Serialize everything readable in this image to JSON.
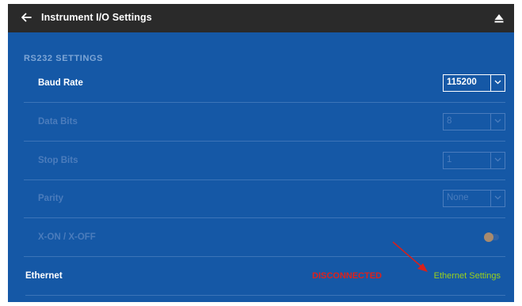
{
  "header": {
    "title": "Instrument I/O Settings",
    "back_icon": "arrow-left-icon",
    "eject_icon": "eject-icon"
  },
  "section": {
    "title": "RS232 SETTINGS"
  },
  "rows": [
    {
      "label": "Baud Rate",
      "value": "115200",
      "enabled": true
    },
    {
      "label": "Data Bits",
      "value": "8",
      "enabled": false
    },
    {
      "label": "Stop Bits",
      "value": "1",
      "enabled": false
    },
    {
      "label": "Parity",
      "value": "None",
      "enabled": false
    }
  ],
  "xon": {
    "label": "X-ON / X-OFF",
    "enabled": false,
    "on": false
  },
  "ethernet": {
    "label": "Ethernet",
    "status": "DISCONNECTED",
    "link": "Ethernet Settings"
  },
  "colors": {
    "background": "#1558a6",
    "header": "#2a2a2a",
    "status_error": "#e0201a",
    "link": "#9ad01b",
    "annotation_arrow": "#d8201a"
  }
}
